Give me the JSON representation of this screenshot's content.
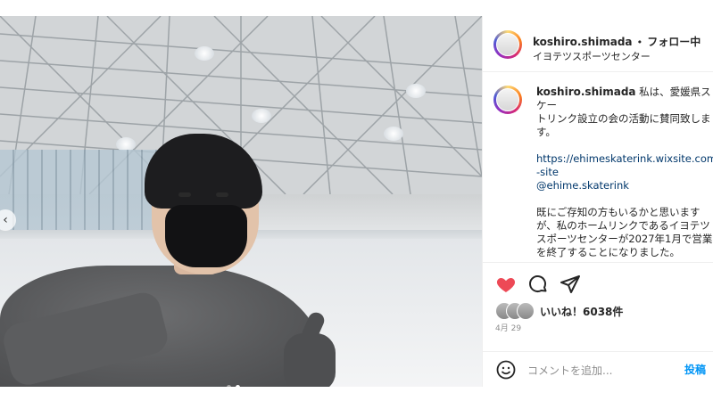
{
  "post": {
    "username": "koshiro.shimada",
    "separator": "•",
    "follow_status": "フォロー中",
    "location": "イヨテツスポーツセンター",
    "caption_user": "koshiro.shimada",
    "caption_line1": "私は、愛媛県スケー",
    "caption_line2": "トリンク設立の会の活動に賛同致しま",
    "caption_line3": "す。",
    "link_url": "https://ehimeskaterink.wixsite.com/",
    "link_suffix": "-site",
    "mention": "@ehime.skaterink",
    "para2_line1": "既にご存知の方もいるかと思います",
    "para2_line2": "が、私のホームリンクであるイヨテツ",
    "para2_line3": "スポーツセンターが2027年1月で営業",
    "para2_line4": "を終了することになりました。",
    "likes_label": "いいね！6038件",
    "date": "4月 29",
    "comment_placeholder": "コメントを追加...",
    "post_label": "投稿"
  },
  "icons": {
    "like": "heart-filled-icon",
    "comment": "comment-bubble-icon",
    "share": "paper-plane-icon",
    "emoji": "smiley-icon",
    "carousel_prev": "chevron-left-icon"
  },
  "colors": {
    "like": "#ed4956",
    "link": "#00376b",
    "post_button": "#0095f6",
    "dot_active": "#ffffff",
    "dot_inactive": "#a8a8a8"
  }
}
